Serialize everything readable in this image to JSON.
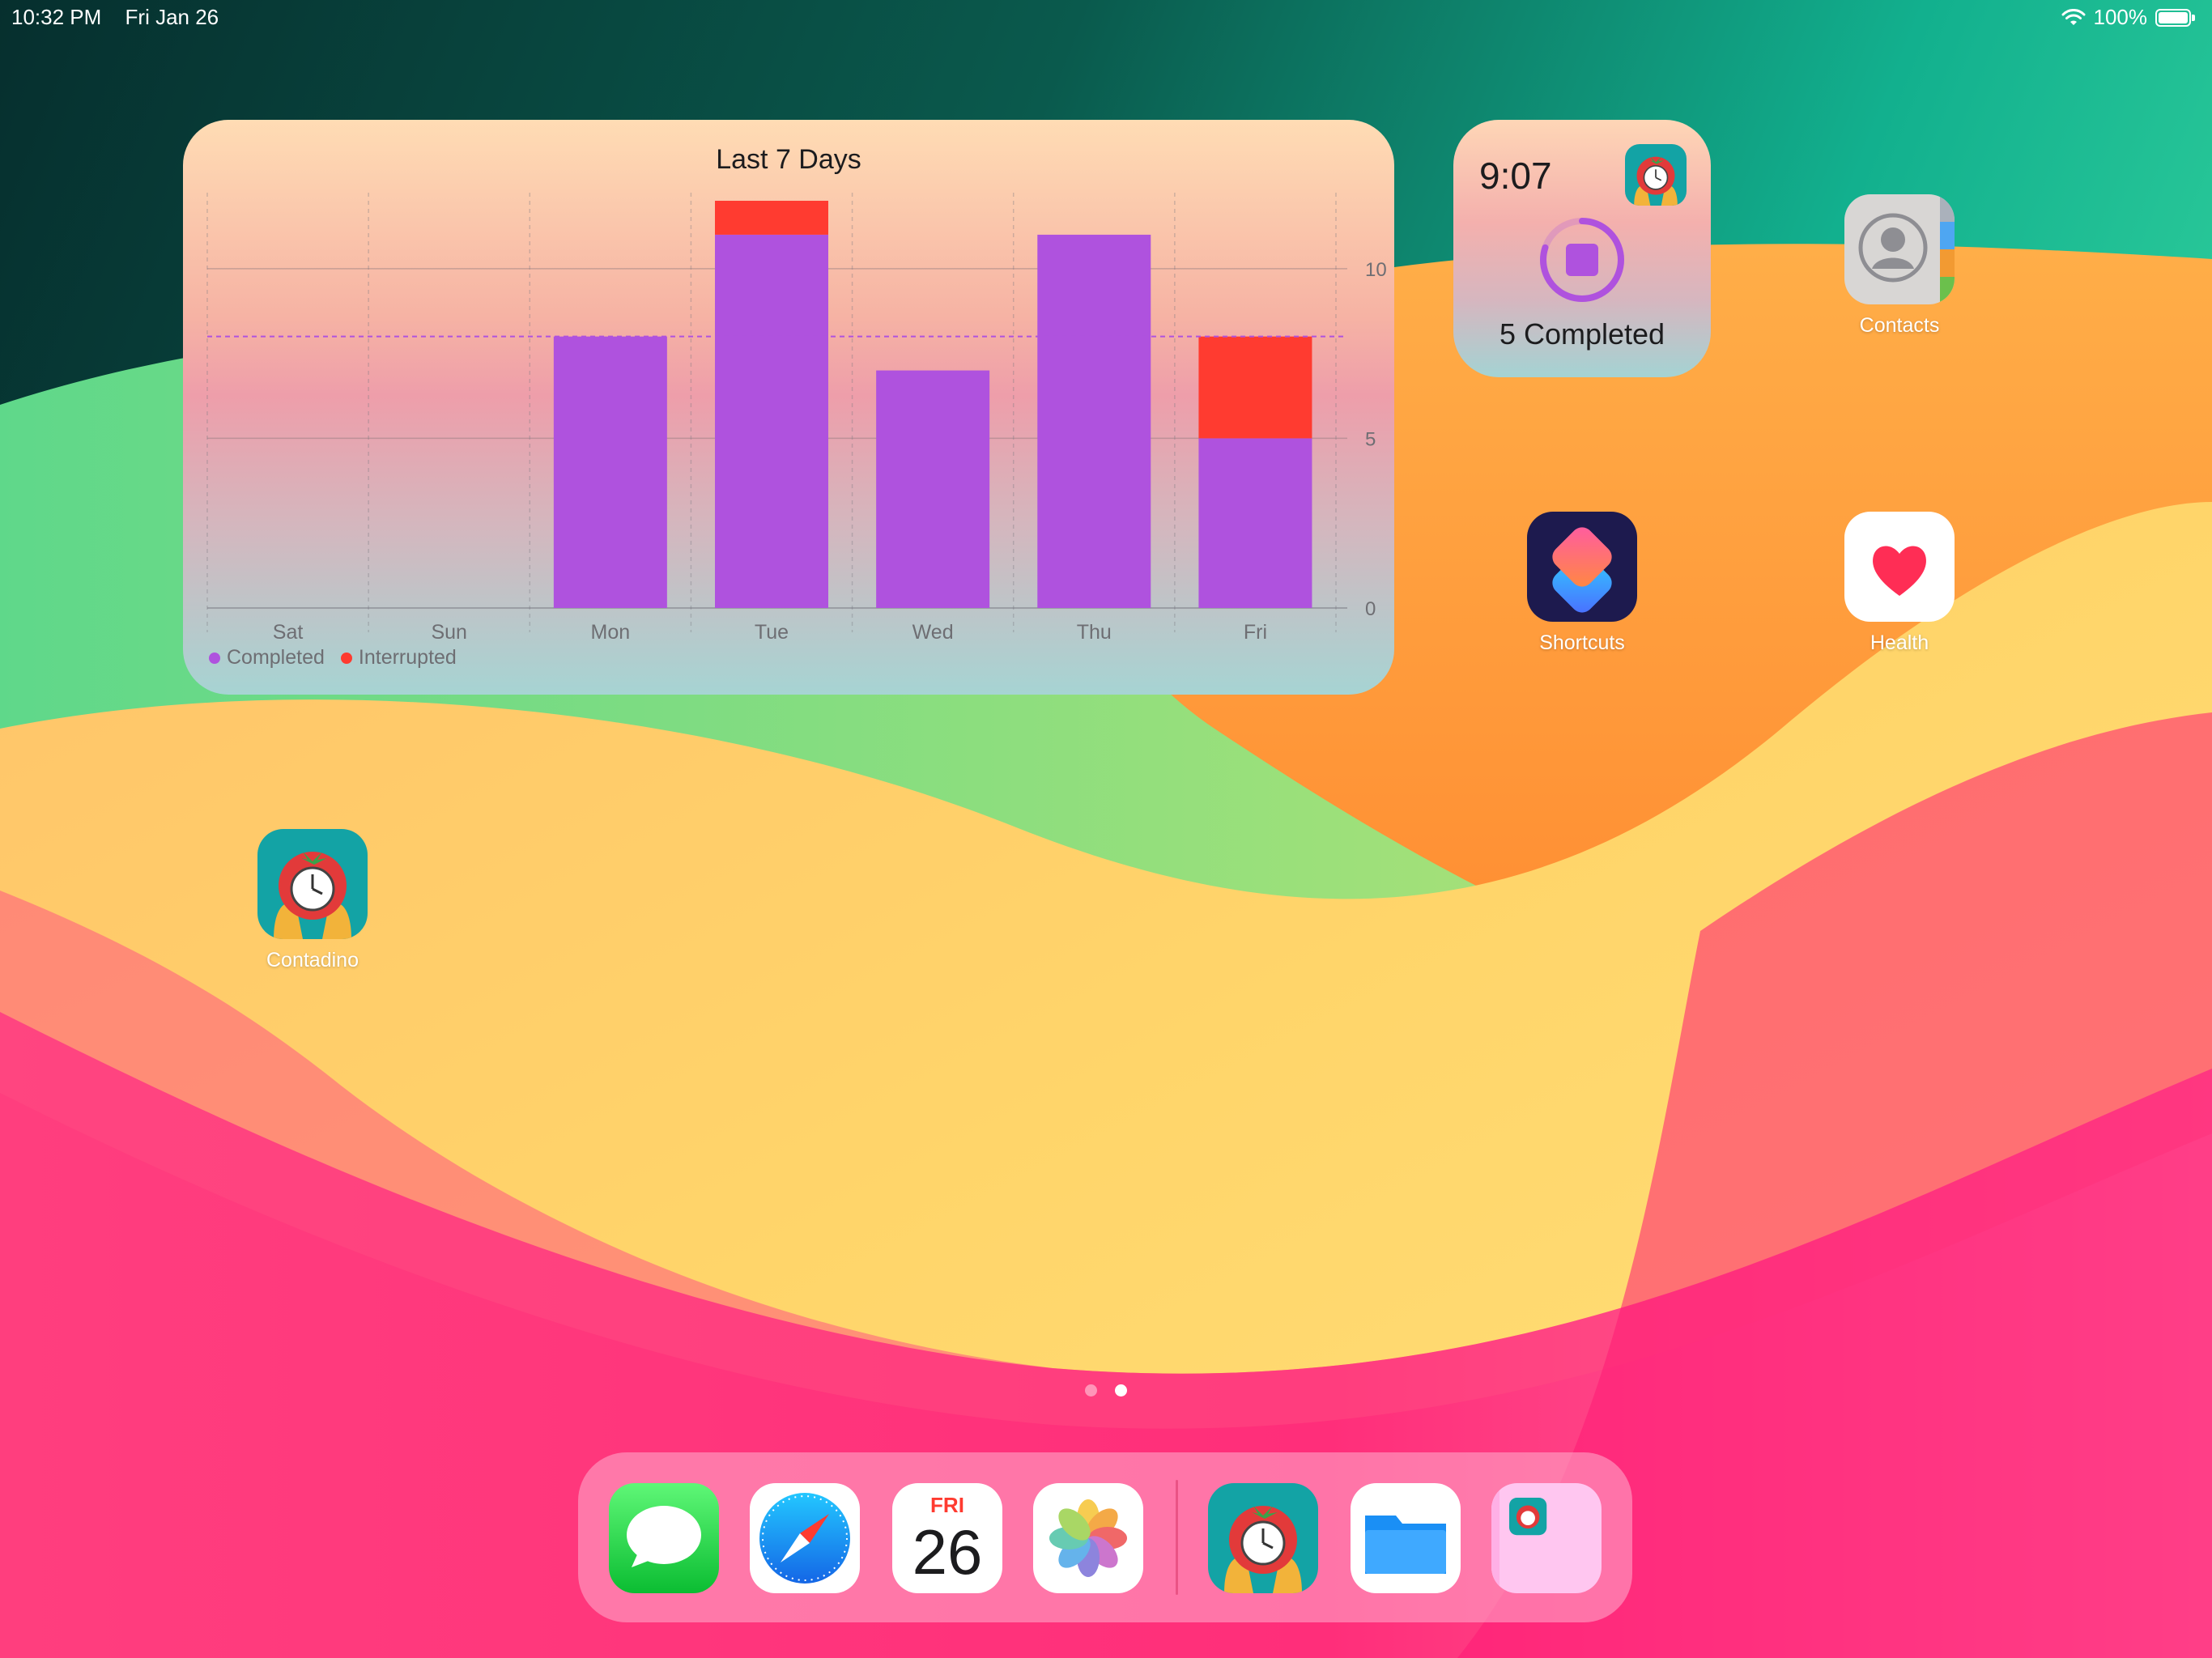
{
  "status_bar": {
    "time": "10:32 PM",
    "date": "Fri Jan 26",
    "battery": "100%",
    "wifi_icon": "wifi-icon"
  },
  "chart_widget": {
    "title": "Last 7 Days",
    "legend": [
      {
        "name": "Completed",
        "color": "#af52de"
      },
      {
        "name": "Interrupted",
        "color": "#ff3b30"
      }
    ]
  },
  "chart_data": {
    "type": "bar",
    "stacked": true,
    "categories": [
      "Sat",
      "Sun",
      "Mon",
      "Tue",
      "Wed",
      "Thu",
      "Fri"
    ],
    "series": [
      {
        "name": "Completed",
        "color": "#af52de",
        "values": [
          0,
          0,
          8,
          11,
          7,
          11,
          5
        ]
      },
      {
        "name": "Interrupted",
        "color": "#ff3b30",
        "values": [
          0,
          0,
          0,
          1,
          0,
          0,
          3
        ]
      }
    ],
    "yticks": [
      0,
      5,
      10
    ],
    "ylim": [
      0,
      12
    ],
    "goal_line": 8,
    "grid": true,
    "legend_position": "bottom-left",
    "y_axis_position": "right"
  },
  "timer_widget": {
    "time": "9:07",
    "completed": "5 Completed",
    "progress": 0.8,
    "stop_icon": "stop-icon"
  },
  "home_apps": [
    {
      "label": "Contacts",
      "icon": "contacts-icon"
    },
    {
      "label": "Shortcuts",
      "icon": "shortcuts-icon"
    },
    {
      "label": "Health",
      "icon": "health-heart-icon"
    },
    {
      "label": "Contadino",
      "icon": "tomato-timer-icon"
    }
  ],
  "dock": {
    "items": [
      {
        "icon": "messages-icon"
      },
      {
        "icon": "safari-icon"
      },
      {
        "icon": "calendar-icon",
        "day_name": "FRI",
        "day_number": "26"
      },
      {
        "icon": "photos-icon"
      },
      {
        "icon": "tomato-timer-icon"
      },
      {
        "icon": "files-icon"
      },
      {
        "icon": "app-library-icon"
      }
    ]
  },
  "pages": {
    "count": 2,
    "current": 2
  }
}
